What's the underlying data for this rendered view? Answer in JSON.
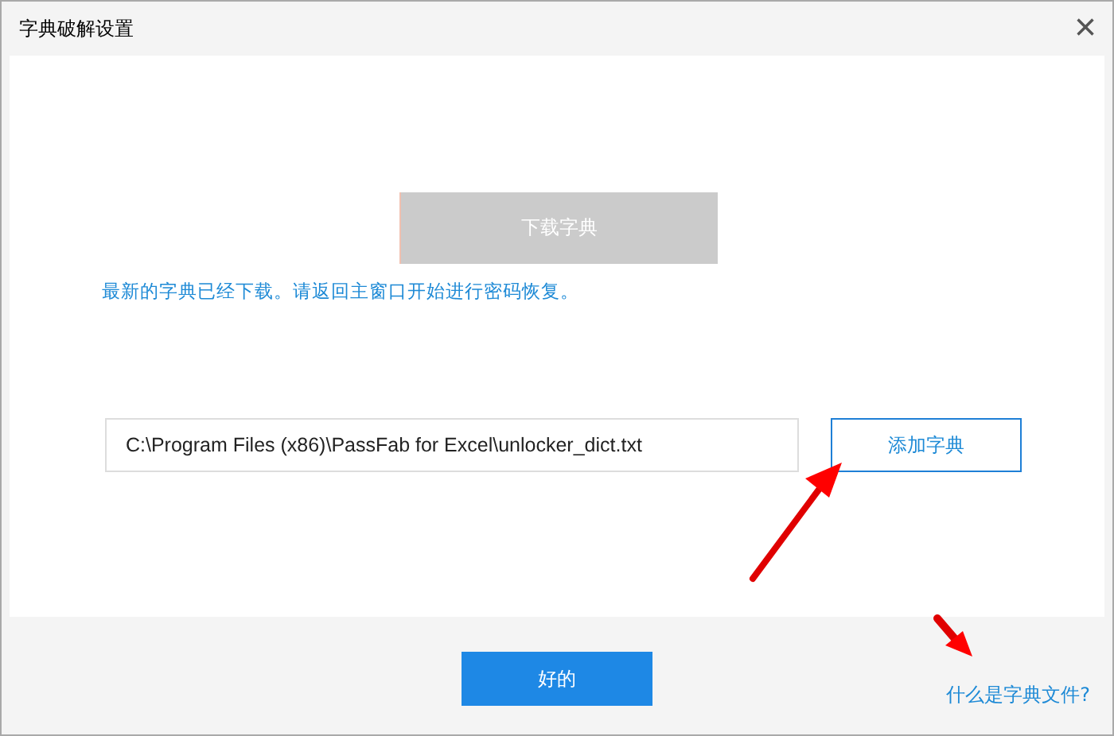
{
  "window": {
    "title": "字典破解设置",
    "close": "×"
  },
  "download_button": {
    "label": "下载字典",
    "disabled": true
  },
  "message": "最新的字典已经下载。请返回主窗口开始进行密码恢复。",
  "path_field": {
    "value": "C:\\Program Files (x86)\\PassFab for Excel\\unlocker_dict.txt"
  },
  "add_button": {
    "label": "添加字典"
  },
  "ok_button": {
    "label": "好的"
  },
  "help_link": "什么是字典文件?"
}
